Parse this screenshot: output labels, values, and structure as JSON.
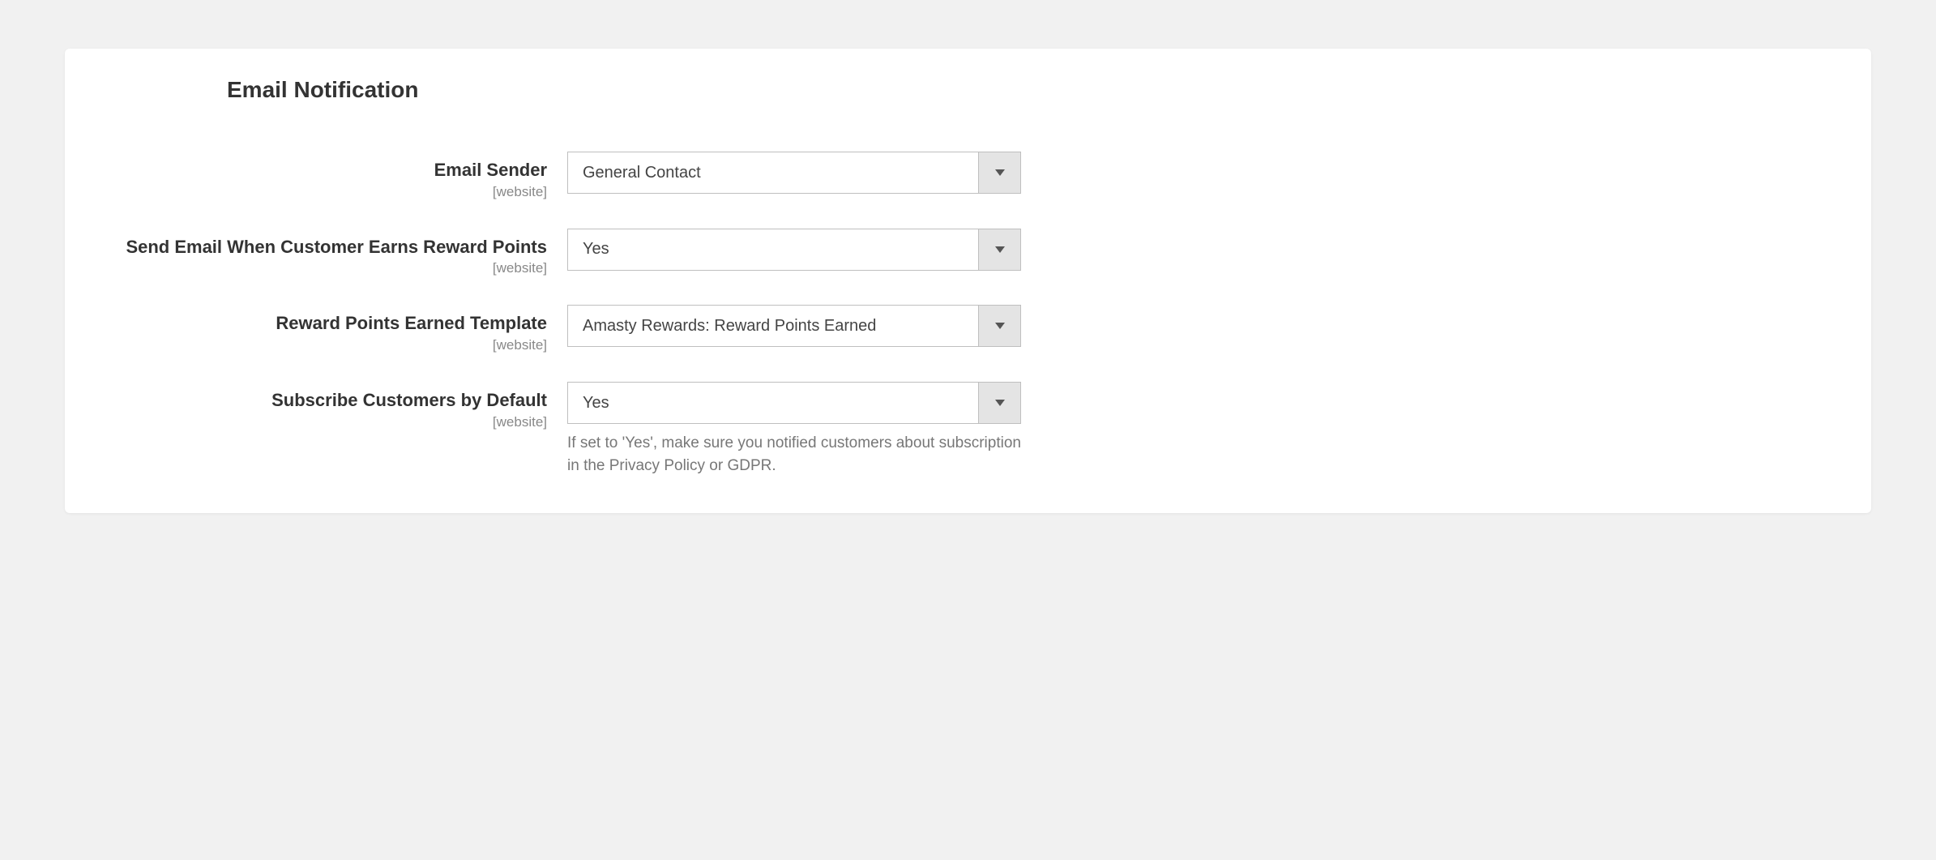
{
  "section": {
    "title": "Email Notification"
  },
  "fields": {
    "email_sender": {
      "label": "Email Sender",
      "scope": "[website]",
      "value": "General Contact"
    },
    "send_email_earns": {
      "label": "Send Email When Customer Earns Reward Points",
      "scope": "[website]",
      "value": "Yes"
    },
    "earned_template": {
      "label": "Reward Points Earned Template",
      "scope": "[website]",
      "value": "Amasty Rewards: Reward Points Earned"
    },
    "subscribe_default": {
      "label": "Subscribe Customers by Default",
      "scope": "[website]",
      "value": "Yes",
      "help": "If set to 'Yes', make sure you notified customers about subscription in the Privacy Policy or GDPR."
    }
  }
}
